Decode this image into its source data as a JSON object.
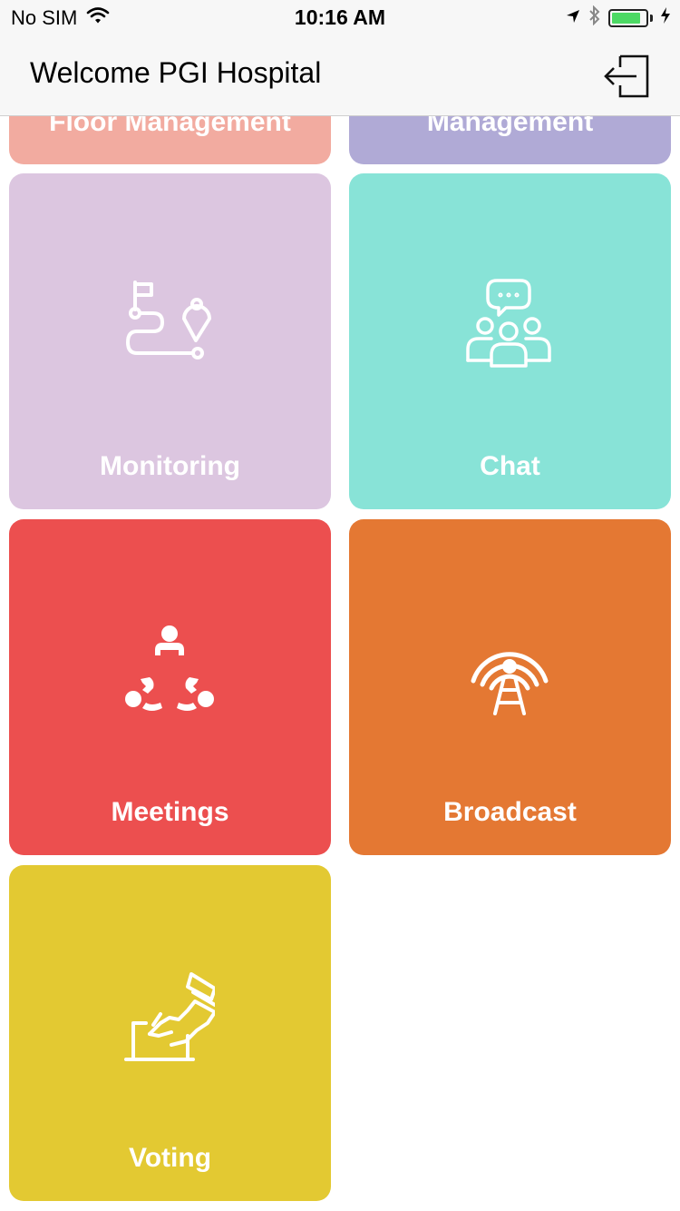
{
  "status_bar": {
    "carrier": "No SIM",
    "time": "10:16 AM",
    "battery_level": 0.85
  },
  "nav": {
    "title": "Welcome PGI Hospital",
    "logout_icon": "logout-icon"
  },
  "tiles": [
    {
      "label": "Floor Management",
      "color": "#f2aba0"
    },
    {
      "label": "Management",
      "color": "#b0aad6"
    },
    {
      "label": "Monitoring",
      "color": "#dcc6e0",
      "icon": "route-map-pin-icon"
    },
    {
      "label": "Chat",
      "color": "#88e3d7",
      "icon": "group-chat-icon"
    },
    {
      "label": "Meetings",
      "color": "#ec4f4f",
      "icon": "meeting-group-icon"
    },
    {
      "label": "Broadcast",
      "color": "#e47833",
      "icon": "broadcast-tower-icon"
    },
    {
      "label": "Voting",
      "color": "#e3c932",
      "icon": "ballot-box-icon"
    }
  ]
}
